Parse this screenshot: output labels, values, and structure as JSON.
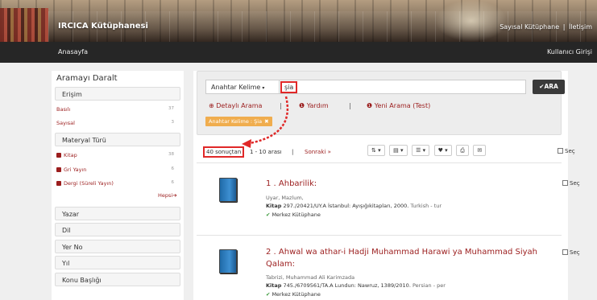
{
  "header": {
    "brand": "IRCICA Kütüphanesi",
    "links": [
      "Sayısal Kütüphane",
      "|",
      "İletişim"
    ]
  },
  "navbar": {
    "home": "Anasayfa",
    "login": "Kullanıcı Girişi"
  },
  "sidebar": {
    "title": "Aramayı Daralt",
    "sections": [
      {
        "label": "Erişim"
      },
      {
        "label": "Materyal Türü"
      },
      {
        "label": "Yazar"
      },
      {
        "label": "Dil"
      },
      {
        "label": "Yer No"
      },
      {
        "label": "Yıl"
      },
      {
        "label": "Konu Başlığı"
      }
    ],
    "access_items": [
      {
        "label": "Basılı",
        "count": "37"
      },
      {
        "label": "Sayısal",
        "count": "3"
      }
    ],
    "material_items": [
      {
        "label": "Kitap",
        "count": "38"
      },
      {
        "label": "Gri Yayın",
        "count": "6"
      },
      {
        "label": "Dergi (Süreli Yayın)",
        "count": "6"
      }
    ],
    "more": "Hepsi"
  },
  "search": {
    "field_select": "Anahtar Kelime",
    "query": "şia",
    "button": "ARA",
    "advanced": "Detaylı Arama",
    "help": "Yardım",
    "new_search": "Yeni Arama (Test)",
    "tag": "Anahtar Kelime : Şia"
  },
  "results_bar": {
    "count": "40 sonuçtan",
    "range": "1 - 10 arası",
    "sep": "|",
    "next": "Sonraki",
    "select_all": "Seç"
  },
  "results": [
    {
      "title": "1 . Ahbarilik:",
      "author": "Uyar, Mazlum,",
      "call_label": "Kitap",
      "call": "297./20421/UY.A  İstanbul: Ayışığıkitapları, 2000.",
      "lang": "Turkish - tur",
      "location": "Merkez Kütüphane",
      "select": "Seç"
    },
    {
      "title": "2 . Ahwal wa athar-i Hadji Muhammad Harawi ya Muhammad Siyah Qalam:",
      "author": "Tabrizi, Muhammad Ali Karimzada",
      "call_label": "Kitap",
      "call": "745./6709561/TA.A  Lundun: Nawruz, 1389/2010.",
      "lang": "Persian - per",
      "location": "Merkez Kütüphane",
      "select": "Seç"
    }
  ],
  "colors": {
    "link": "#9b1d1d",
    "highlight": "#e02828",
    "tag": "#f0ad4e",
    "navbar": "#262626",
    "button": "#3a3a3a"
  }
}
